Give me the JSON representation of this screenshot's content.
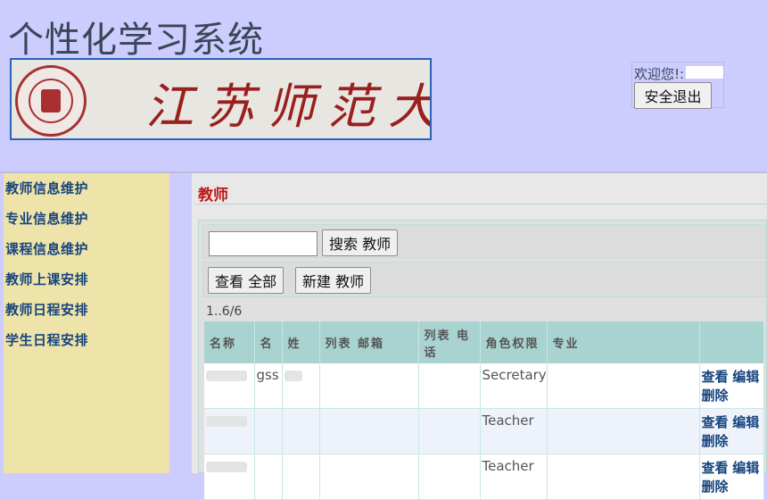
{
  "header": {
    "app_title": "个性化学习系统",
    "banner_calligraphy": "江苏师范大学",
    "welcome_text": "欢迎您!:",
    "logout_label": "安全退出"
  },
  "sidebar": {
    "items": [
      {
        "label": "教师信息维护"
      },
      {
        "label": "专业信息维护"
      },
      {
        "label": "课程信息维护"
      },
      {
        "label": "教师上课安排"
      },
      {
        "label": "教师日程安排"
      },
      {
        "label": "学生日程安排"
      }
    ]
  },
  "main": {
    "page_title": "教师",
    "search": {
      "value": "",
      "placeholder": "",
      "button_label": "搜索 教师"
    },
    "view_all_label": "查看 全部",
    "new_label": "新建 教师",
    "record_count": "1..6/6",
    "table": {
      "headers": [
        "名称",
        "名",
        "姓",
        "列表 邮箱",
        "列表 电话",
        "角色权限",
        "专业",
        ""
      ],
      "rows": [
        {
          "given_name": "gss",
          "role": "Secretary",
          "view": "查看",
          "edit": "编辑",
          "delete": "删除"
        },
        {
          "given_name": "",
          "role": "Teacher",
          "view": "查看",
          "edit": "编辑",
          "delete": "删除"
        },
        {
          "given_name": "",
          "role": "Teacher",
          "view": "查看",
          "edit": "编辑",
          "delete": "删除"
        }
      ]
    }
  },
  "colors": {
    "page_bg": "#ccccff",
    "sidebar_bg": "#eee3a8",
    "nav_text": "#17457f",
    "page_title": "#c01818",
    "table_header": "#a9d3d0"
  }
}
